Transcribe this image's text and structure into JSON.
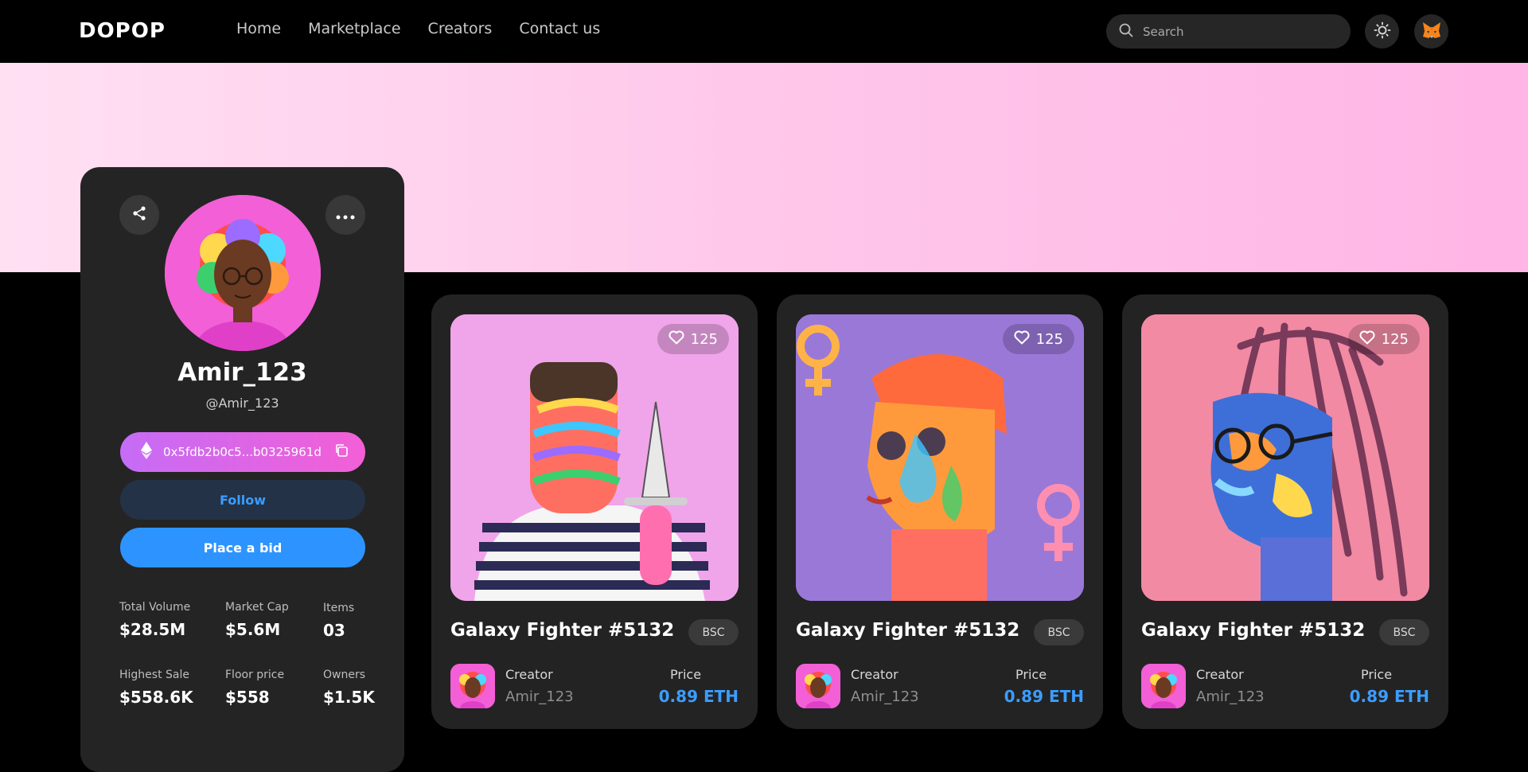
{
  "header": {
    "logo": "DOPOP",
    "nav": [
      "Home",
      "Marketplace",
      "Creators",
      "Contact us"
    ],
    "search_placeholder": "Search",
    "icons": [
      "search-icon",
      "sun-icon",
      "metamask-fox-icon"
    ]
  },
  "profile": {
    "name": "Amir_123",
    "handle": "@Amir_123",
    "wallet": "0x5fdb2b0c5...b0325961d",
    "follow_label": "Follow",
    "bid_label": "Place a bid",
    "stats": [
      {
        "label": "Total Volume",
        "value": "$28.5M"
      },
      {
        "label": "Market Cap",
        "value": "$5.6M"
      },
      {
        "label": "Items",
        "value": "03"
      },
      {
        "label": "Highest Sale",
        "value": "$558.6K"
      },
      {
        "label": "Floor price",
        "value": "$558"
      },
      {
        "label": "Owners",
        "value": "$1.5K"
      }
    ]
  },
  "cards": [
    {
      "title": "Galaxy Fighter #5132",
      "likes": "125",
      "chain": "BSC",
      "creator_label": "Creator",
      "creator": "Amir_123",
      "price_label": "Price",
      "price": "0.89 ETH"
    },
    {
      "title": "Galaxy Fighter #5132",
      "likes": "125",
      "chain": "BSC",
      "creator_label": "Creator",
      "creator": "Amir_123",
      "price_label": "Price",
      "price": "0.89 ETH"
    },
    {
      "title": "Galaxy Fighter #5132",
      "likes": "125",
      "chain": "BSC",
      "creator_label": "Creator",
      "creator": "Amir_123",
      "price_label": "Price",
      "price": "0.89 ETH"
    }
  ],
  "colors": {
    "accent_blue": "#2d94ff",
    "price_blue": "#3b9dff",
    "wallet_gradient_start": "#c56cf6",
    "wallet_gradient_end": "#f35fd6",
    "banner": "#ffc7ea",
    "card_bg": "#232323",
    "art_backgrounds": [
      "#f0a4ea",
      "#9a78d8",
      "#f28aa4"
    ]
  }
}
